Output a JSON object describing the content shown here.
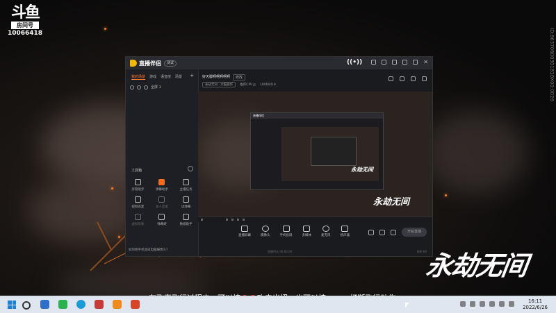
{
  "overlay": {
    "brand_mark": "斗鱼",
    "room_label": "房间号",
    "room_number": "10066418",
    "side_id": "ID:86370600301810X00:0026",
    "game_logo": "永劫无间"
  },
  "window": {
    "app_name": "直播伴侣",
    "version_badge": "测试"
  },
  "left_panel": {
    "tabs": [
      "我的场景",
      "游戏",
      "语音房",
      "场景"
    ],
    "add": "+",
    "scene_label": "全屏 1",
    "tools_title": "工具箱",
    "tools": [
      {
        "label": "房管助手",
        "hot": false,
        "dim": false
      },
      {
        "label": "弹幕助手",
        "hot": true,
        "dim": false
      },
      {
        "label": "主播任务",
        "hot": false,
        "dim": false
      },
      {
        "label": "视频连麦",
        "hot": false,
        "dim": false
      },
      {
        "label": "多人连麦",
        "hot": false,
        "dim": true
      },
      {
        "label": "读弹幕",
        "hot": false,
        "dim": false
      },
      {
        "label": "虚拟形象",
        "hot": false,
        "dim": true
      },
      {
        "label": "弹幕姬",
        "hot": false,
        "dim": false
      },
      {
        "label": "数据助手",
        "hot": false,
        "dim": false
      }
    ],
    "note": "如何把手机变成电脑摄像头？"
  },
  "stream": {
    "tabs": [
      "好天脚啊啊啊啊啊",
      "修改"
    ],
    "info_items": [
      "永劫无间 · 大脑操作",
      "推荐CPU占",
      "10066418"
    ],
    "preview_logo": "永劫无间",
    "inner_app_name": "直播伴侣"
  },
  "controls": [
    {
      "label": "直播屏幕"
    },
    {
      "label": "摄像头"
    },
    {
      "label": "手机投屏"
    },
    {
      "label": "多媒体"
    },
    {
      "label": "麦克风"
    },
    {
      "label": "扬声器"
    }
  ],
  "go_live": "开始直播",
  "statusline": {
    "left": "直播时长 00:00:00",
    "right": "帧率 60"
  },
  "subtitle": {
    "before": "在飞索飞行过程中，可以按",
    "middle": "攻击出招，也可以按",
    "key": "Space",
    "after": "打断飞行动作"
  },
  "clock": {
    "time": "16:11",
    "date": "2022/6/26"
  },
  "colors": {
    "accent": "#ff7a2a",
    "brand_yellow": "#f5b800",
    "taskbar": "#dfe6ef"
  }
}
